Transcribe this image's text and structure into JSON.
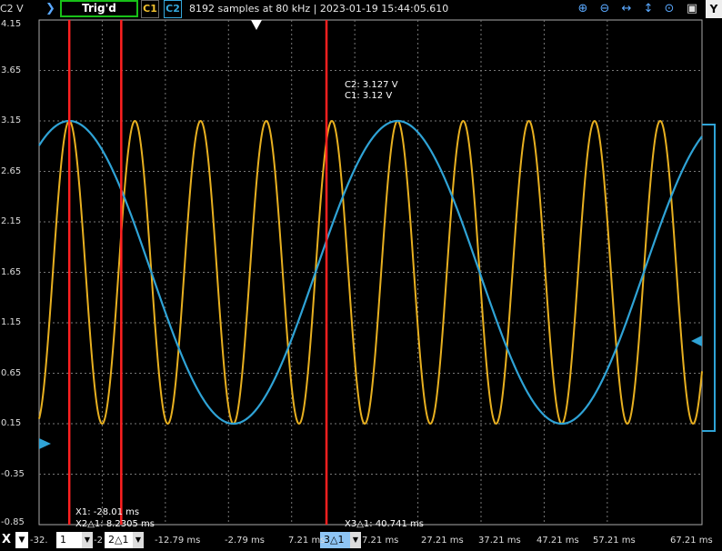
{
  "header": {
    "y_channel_label": "C2 V",
    "trigger_status": "Trig'd",
    "ch1_label": "C1",
    "ch2_label": "C2",
    "status_text": "8192 samples at 80 kHz | 2023-01-19 15:44:05.610",
    "y_button_label": "Y",
    "icons": [
      "zoom-in-icon",
      "zoom-out-icon",
      "zoom-fit-horizontal-icon",
      "zoom-fit-vertical-icon",
      "zoom-reset-icon",
      "camera-icon"
    ]
  },
  "y_axis": {
    "ticks": [
      "4.15",
      "3.65",
      "3.15",
      "2.65",
      "2.15",
      "1.65",
      "1.15",
      "0.65",
      "0.15",
      "-0.35",
      "-0.85"
    ]
  },
  "x_axis": {
    "ticks": [
      "-32.",
      "-2",
      "-12.79 ms",
      "-2.79 ms",
      "7.21 ms",
      "7.21 ms",
      "27.21 ms",
      "37.21 ms",
      "47.21 ms",
      "57.21 ms",
      "67.21 ms"
    ]
  },
  "cursors": {
    "readout_c2": "C2: 3.127 V",
    "readout_c1": "C1: 3.12 V",
    "x1_label": "X1: -28.01 ms",
    "x2_label": "X2△1: 8.2305 ms",
    "x3_label": "X3△1: 40.741 ms"
  },
  "bottom": {
    "x_button_label": "X",
    "select1_value": "1",
    "select2_value": "2△1",
    "select3_value": "3△1"
  },
  "chart_data": {
    "type": "line",
    "ylim": [
      -0.85,
      4.15
    ],
    "xlim": [
      -32.79,
      72.21
    ],
    "x_unit": "ms",
    "grid": true,
    "colors": {
      "C1": "#e8b020",
      "C2": "#2fa3d6",
      "cursor": "#ff2020"
    },
    "series": [
      {
        "name": "C1",
        "offset": 1.65,
        "amplitude": 1.5,
        "period_ms": 10.4,
        "peak_at_ms": -28.01
      },
      {
        "name": "C2",
        "offset": 1.65,
        "amplitude": 1.5,
        "period_ms": 52.0,
        "peak_at_ms": -28.01
      }
    ],
    "cursors_ms": [
      -28.01,
      -19.7795,
      12.731
    ]
  }
}
